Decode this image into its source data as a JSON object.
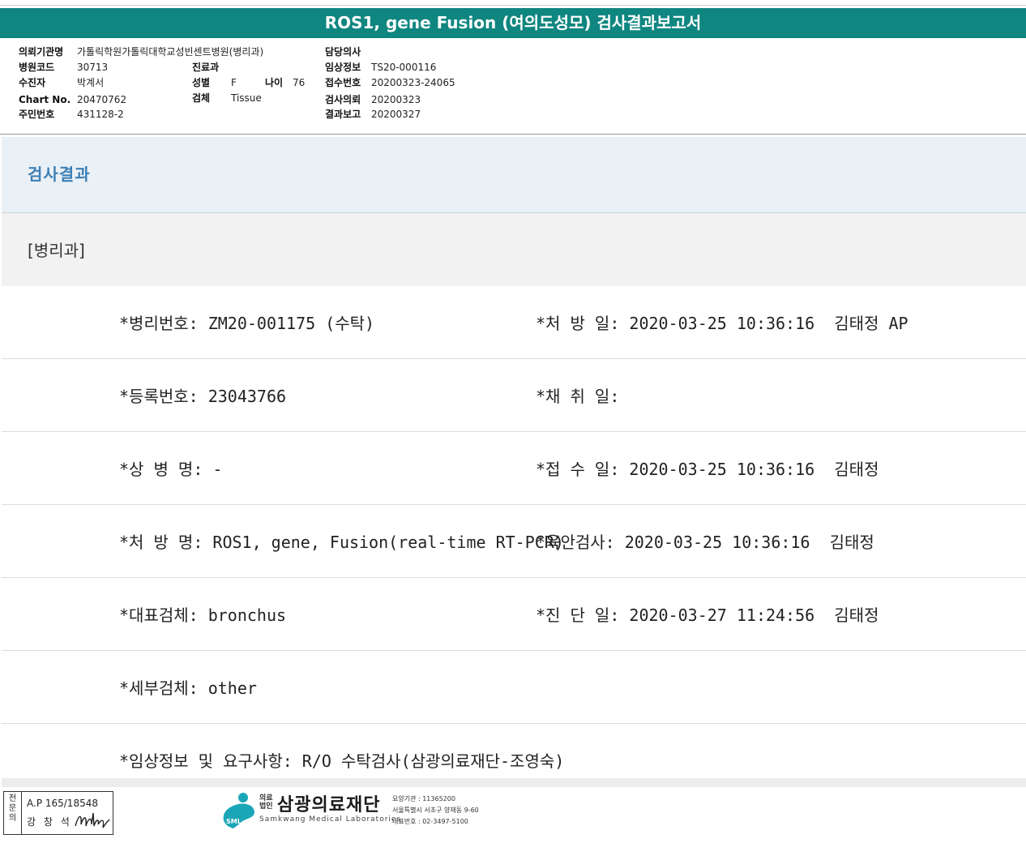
{
  "title": "ROS1, gene Fusion (여의도성모) 검사결과보고서",
  "info": {
    "institution_label": "의뢰기관명",
    "institution": "가톨릭학원가톨릭대학교성빈센트병원(병리과)",
    "hospital_code_label": "병원코드",
    "hospital_code": "30713",
    "dept_label": "진료과",
    "recipient_label": "수진자",
    "recipient": "박계서",
    "sex_label": "성별",
    "sex": "F",
    "age_label": "나이",
    "age": "76",
    "chart_label": "Chart No.",
    "chart_no": "20470762",
    "specimen_label": "검체",
    "specimen": "Tissue",
    "id_label": "주민번호",
    "id_no": "431128-2",
    "doctor_label": "담당의사",
    "clinical_label": "임상정보",
    "clinical": "TS20-000116",
    "receipt_no_label": "접수번호",
    "receipt_no": "20200323-24065",
    "request_label": "검사의뢰",
    "request_date": "20200323",
    "report_label": "결과보고",
    "report_date": "20200327"
  },
  "section_title": "검사결과",
  "dept_title": "[병리과]",
  "rows": [
    {
      "left": "*병리번호: ZM20-001175 (수탁)",
      "right": "*처 방 일: 2020-03-25 10:36:16  김태정 AP"
    },
    {
      "left": "*등록번호: 23043766",
      "right": "*채 취 일:"
    },
    {
      "left": "*상 병 명: -",
      "right": "*접 수 일: 2020-03-25 10:36:16  김태정"
    },
    {
      "left": "*처 방 명: ROS1, gene, Fusion(real-time RT-PCR)",
      "right": "*육안검사: 2020-03-25 10:36:16  김태정"
    },
    {
      "left": "*대표검체: bronchus",
      "right": "*진 단 일: 2020-03-27 11:24:56  김태정"
    },
    {
      "left": "*세부검체: other",
      "right": ""
    },
    {
      "left": "*임상정보 및 요구사항: R/O 수탁검사(삼광의료재단-조영숙)",
      "right": ""
    }
  ],
  "stamp": {
    "side": "전문의",
    "license": "A.P 165/18548",
    "name": "강 창 석"
  },
  "footer": {
    "org_prefix": "의료 법인",
    "org_name": "삼광의료재단",
    "org_eng": "Samkwang Medical Laboratories",
    "logo_text": "SML",
    "code": "요양기관 : 11365200",
    "address": "서울특별시 서초구 양재동 9-60",
    "phone": "대표번호 : 02-3497-5100"
  },
  "colors": {
    "title_bg": "#0f8680",
    "section_bg": "#eaf1f6",
    "section_text": "#3d7fb5",
    "logo": "#1aa6b7"
  }
}
